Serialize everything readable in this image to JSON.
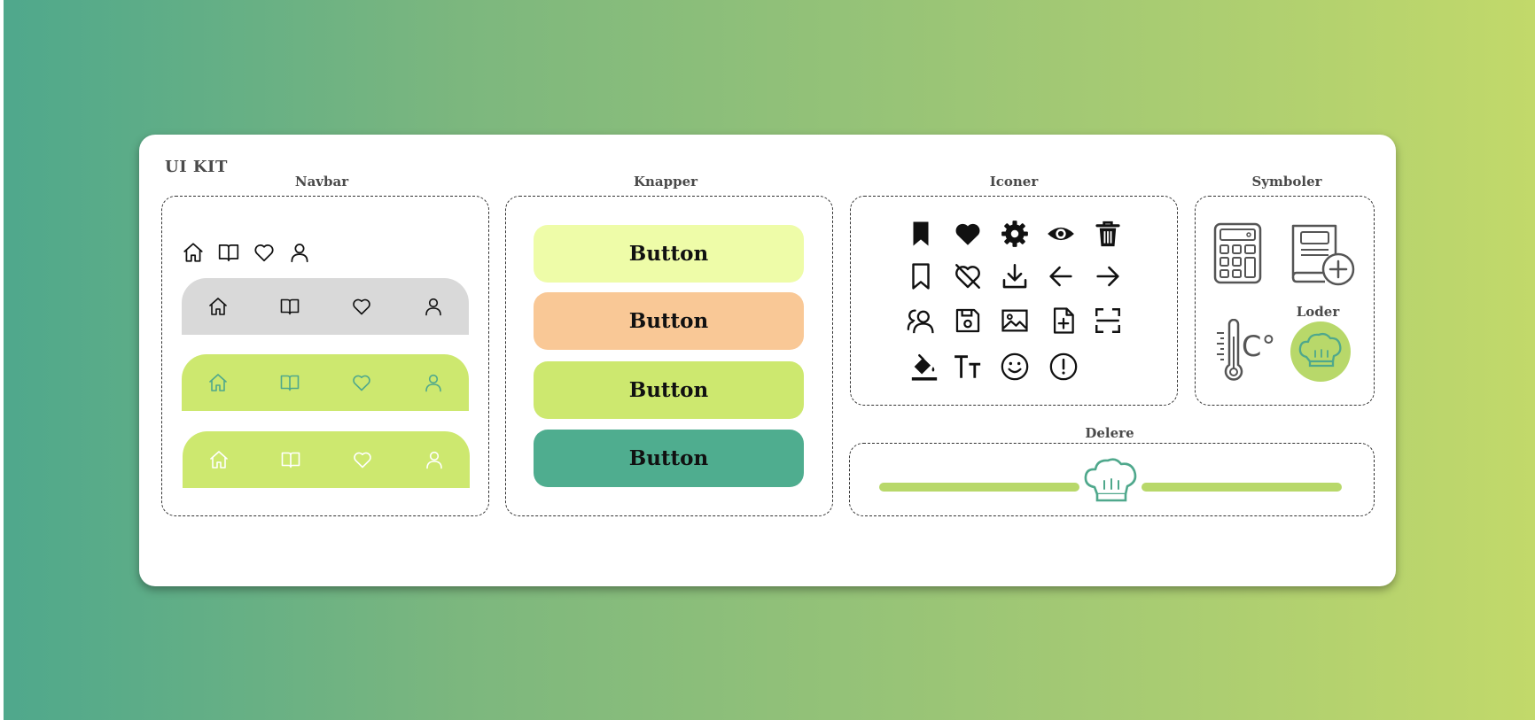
{
  "title": "UI KIT",
  "sections": {
    "navbar": "Navbar",
    "buttons": "Knapper",
    "icons": "Iconer",
    "symbols": "Symboler",
    "loader": "Loder",
    "divider": "Delere"
  },
  "navbar": {
    "items": [
      "home-icon",
      "book-icon",
      "heart-icon",
      "user-icon"
    ],
    "variants": [
      {
        "bg": "#d9d9d9",
        "icon_color": "#111111"
      },
      {
        "bg": "#cde86f",
        "icon_color": "#4fa88c"
      },
      {
        "bg": "#cde86f",
        "icon_color": "#ffffff"
      }
    ]
  },
  "buttons": [
    {
      "label": "Button",
      "bg": "#eefca8"
    },
    {
      "label": "Button",
      "bg": "#f9c896"
    },
    {
      "label": "Button",
      "bg": "#cde86f"
    },
    {
      "label": "Button",
      "bg": "#4fad8f"
    }
  ],
  "icons": [
    [
      "bookmark-filled-icon",
      "heart-filled-icon",
      "gear-icon",
      "eye-icon",
      "trash-icon"
    ],
    [
      "bookmark-outline-icon",
      "heart-off-icon",
      "download-icon",
      "arrow-left-icon",
      "arrow-right-icon"
    ],
    [
      "users-icon",
      "save-icon",
      "image-icon",
      "file-add-icon",
      "scan-icon"
    ],
    [
      "paint-bucket-icon",
      "text-size-icon",
      "smiley-icon",
      "alert-circle-icon"
    ]
  ],
  "icon_text": {
    "text_size": "TT"
  },
  "symbols": {
    "temp_unit": "C°"
  },
  "colors": {
    "accent_green": "#cde86f",
    "teal": "#4fad8f",
    "slider": "#b8d86a"
  }
}
